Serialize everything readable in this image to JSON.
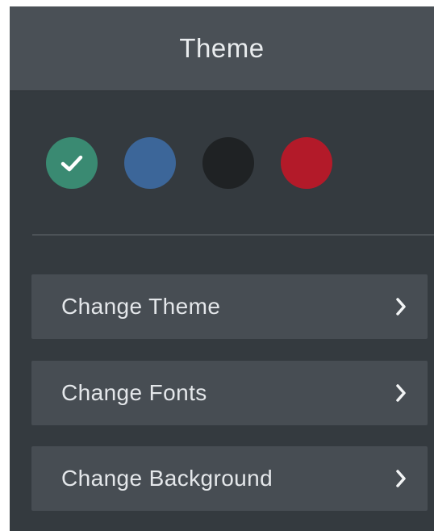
{
  "header": {
    "title": "Theme"
  },
  "swatches": [
    {
      "name": "green",
      "color": "#3a8a72",
      "selected": true
    },
    {
      "name": "blue",
      "color": "#3c6699",
      "selected": false
    },
    {
      "name": "black",
      "color": "#1f2224",
      "selected": false
    },
    {
      "name": "red",
      "color": "#b31a29",
      "selected": false
    }
  ],
  "menu": {
    "items": [
      {
        "label": "Change Theme",
        "icon": "chevron-right-icon"
      },
      {
        "label": "Change Fonts",
        "icon": "chevron-right-icon"
      },
      {
        "label": "Change Background",
        "icon": "chevron-right-icon"
      }
    ]
  },
  "colors": {
    "panel_bg": "#343a3f",
    "header_bg": "#4a5056",
    "item_bg": "#474d53",
    "text": "#e4e7ea"
  }
}
